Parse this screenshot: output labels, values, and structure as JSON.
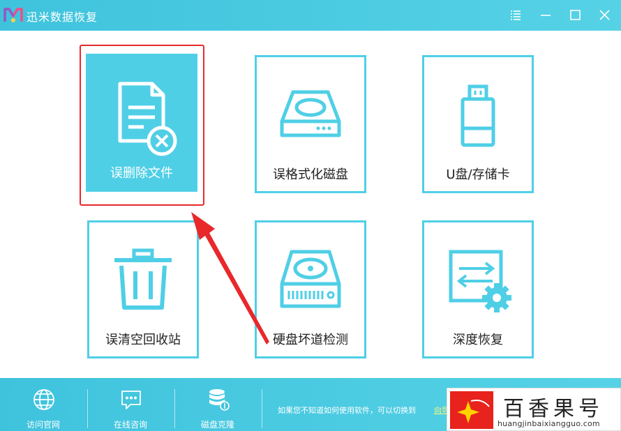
{
  "window": {
    "title": "迅米数据恢复",
    "accent_color": "#4fcfe6",
    "controls": [
      "menu-icon",
      "minimize-icon",
      "maximize-icon",
      "close-icon"
    ]
  },
  "tiles": [
    {
      "label": "误删除文件",
      "icon": "deleted-file-icon",
      "selected": true
    },
    {
      "label": "误格式化磁盘",
      "icon": "disk-icon",
      "selected": false
    },
    {
      "label": "U盘/存储卡",
      "icon": "usb-drive-icon",
      "selected": false
    },
    {
      "label": "误清空回收站",
      "icon": "trash-icon",
      "selected": false
    },
    {
      "label": "硬盘坏道检测",
      "icon": "hard-disk-icon",
      "selected": false
    },
    {
      "label": "深度恢复",
      "icon": "deep-recovery-icon",
      "selected": false
    }
  ],
  "annotation": {
    "highlight_color": "#e8282b"
  },
  "footer": {
    "items": [
      {
        "label": "访问官网",
        "icon": "globe-icon"
      },
      {
        "label": "在线咨询",
        "icon": "chat-icon"
      },
      {
        "label": "磁盘克隆",
        "icon": "database-icon"
      }
    ],
    "hint": "如果您不知道如何使用软件，可以切换到",
    "link": "向导"
  },
  "watermark": {
    "brand": "百香果号",
    "url": "huangjinbaixiangguo.com"
  }
}
